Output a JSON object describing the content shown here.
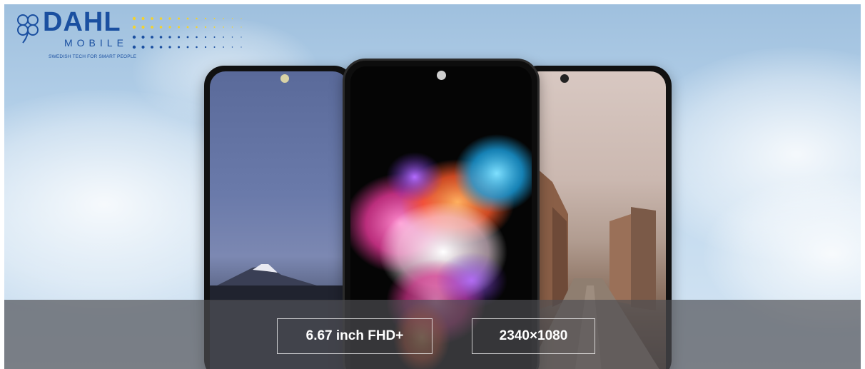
{
  "logo": {
    "brand": "DAHL",
    "sub": "MOBILE",
    "tagline": "SWEDISH TECH FOR SMART PEOPLE"
  },
  "specs": [
    {
      "label": "6.67 inch FHD+"
    },
    {
      "label": "2340×1080"
    }
  ],
  "colors": {
    "brand_blue": "#1a4fa0",
    "brand_yellow": "#f2d230",
    "band": "#4e4e52"
  }
}
